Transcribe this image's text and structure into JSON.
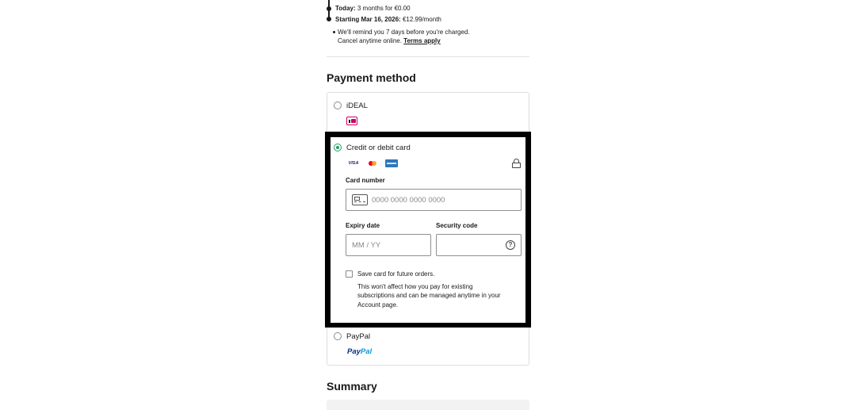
{
  "trial": {
    "today_label": "Today:",
    "today_text": "3 months for €0.00",
    "starting_label": "Starting Mar 16, 2026:",
    "starting_text": "€12.99/month"
  },
  "notes": {
    "line1": "We'll remind you 7 days before you're charged.",
    "line2": "Cancel anytime online.",
    "terms_link": "Terms apply"
  },
  "payment": {
    "title": "Payment method",
    "options": [
      {
        "label": "iDEAL",
        "selected": false,
        "logo": "ideal-logo"
      },
      {
        "label": "Credit or debit card",
        "selected": true,
        "logos": [
          "visa-logo",
          "mastercard-logo",
          "amex-logo"
        ]
      },
      {
        "label": "PayPal",
        "selected": false,
        "logo_part1": "Pay",
        "logo_part2": "Pal"
      }
    ]
  },
  "card_form": {
    "card_number_label": "Card number",
    "card_number_placeholder": "0000 0000 0000 0000",
    "expiry_label": "Expiry date",
    "expiry_placeholder": "MM / YY",
    "security_label": "Security code",
    "security_placeholder": "",
    "save_label": "Save card for future orders.",
    "save_checked": false,
    "save_help": "This won't affect how you pay for existing subscriptions and can be managed anytime in your Account page."
  },
  "summary": {
    "title": "Summary"
  },
  "colors": {
    "accent_green": "#1f9e5a",
    "text": "#1a1a1a",
    "border": "#dedede"
  }
}
